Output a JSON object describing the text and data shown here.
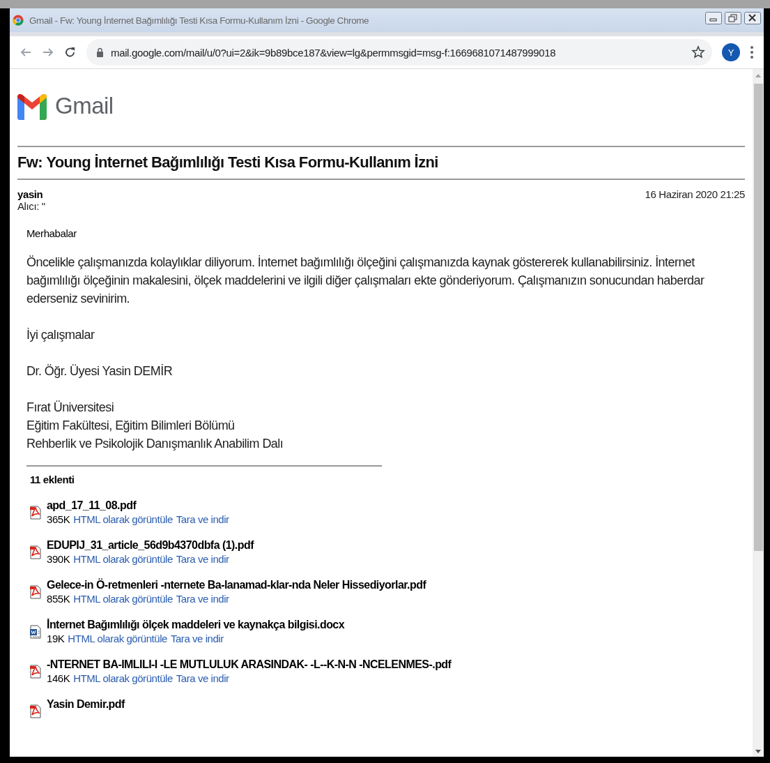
{
  "window": {
    "title": "Gmail - Fw: Young İnternet Bağımlılığı Testi Kısa Formu-Kullanım İzni - Google Chrome"
  },
  "address_bar": {
    "url": "mail.google.com/mail/u/0?ui=2&ik=9b89bce187&view=lg&permmsgid=msg-f:1669681071487999018",
    "bookmarked": false,
    "profile_initial": "Y"
  },
  "logo": {
    "text": "Gmail"
  },
  "message": {
    "subject": "Fw: Young İnternet Bağımlılığı Testi Kısa Formu-Kullanım İzni",
    "sender": "yasin",
    "recipient": "Alıcı: \"",
    "date": "16 Haziran 2020 21:25",
    "greeting": "Merhabalar",
    "paragraphs": [
      [
        "Öncelikle çalışmanızda kolaylıklar diliyorum. İnternet bağımlılığı ölçeğini çalışmanızda kaynak göstererek kullanabilirsiniz. İnternet bağımlılığı ölçeğinin makalesini, ölçek maddelerini ve ilgili diğer çalışmaları ekte gönderiyorum. Çalışmanızın sonucundan haberdar ederseniz sevinirim."
      ],
      [
        "İyi çalışmalar"
      ],
      [
        "Dr. Öğr. Üyesi Yasin DEMİR"
      ],
      [
        "Fırat Üniversitesi",
        "Eğitim Fakültesi, Eğitim Bilimleri Bölümü",
        "Rehberlik ve Psikolojik Danışmanlık Anabilim Dalı"
      ]
    ]
  },
  "attachments": {
    "count": "11 eklenti",
    "items": [
      {
        "kind": "pdf",
        "name": "apd_17_11_08.pdf",
        "size": "365K",
        "links": [
          "HTML olarak görüntüle",
          "Tara ve indir"
        ]
      },
      {
        "kind": "pdf",
        "name": "EDUPIJ_31_article_56d9b4370dbfa (1).pdf",
        "size": "390K",
        "links": [
          "HTML olarak görüntüle",
          "Tara ve indir"
        ]
      },
      {
        "kind": "pdf",
        "name": "Gelece-in Ö-retmenleri -nternete Ba-lanamad-klar-nda Neler Hissediyorlar.pdf",
        "size": "855K",
        "links": [
          "HTML olarak görüntüle",
          "Tara ve indir"
        ]
      },
      {
        "kind": "doc",
        "name": "İnternet Bağımlılığı ölçek maddeleri ve kaynakça bilgisi.docx",
        "size": "19K",
        "links": [
          "HTML olarak görüntüle",
          "Tara ve indir"
        ]
      },
      {
        "kind": "pdf",
        "name": "-NTERNET BA-IMLILI-I -LE MUTLULUK ARASINDAK- -L--K-N-N -NCELENMES-.pdf",
        "size": "146K",
        "links": [
          "HTML olarak görüntüle",
          "Tara ve indir"
        ]
      },
      {
        "kind": "pdf",
        "name": "Yasin Demir.pdf"
      }
    ]
  }
}
